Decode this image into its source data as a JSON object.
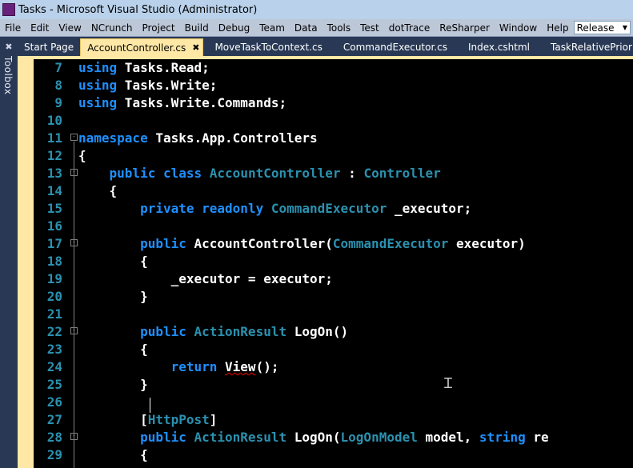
{
  "window": {
    "title": "Tasks - Microsoft Visual Studio (Administrator)"
  },
  "menu": {
    "items": [
      "File",
      "Edit",
      "View",
      "NCrunch",
      "Project",
      "Build",
      "Debug",
      "Team",
      "Data",
      "Tools",
      "Test",
      "dotTrace",
      "ReSharper",
      "Window",
      "Help"
    ],
    "configuration": "Release"
  },
  "toolbox": {
    "label": "Toolbox"
  },
  "tabs": [
    {
      "label": "Start Page",
      "active": false
    },
    {
      "label": "AccountController.cs",
      "active": true
    },
    {
      "label": "MoveTaskToContext.cs",
      "active": false
    },
    {
      "label": "CommandExecutor.cs",
      "active": false
    },
    {
      "label": "Index.cshtml",
      "active": false
    },
    {
      "label": "TaskRelativePriority.cs",
      "active": false
    }
  ],
  "editor": {
    "lines": [
      {
        "num": "7",
        "fold": "",
        "tokens": [
          [
            "kw",
            "using"
          ],
          [
            "id",
            " Tasks.Read;"
          ]
        ]
      },
      {
        "num": "8",
        "fold": "",
        "tokens": [
          [
            "kw",
            "using"
          ],
          [
            "id",
            " Tasks.Write;"
          ]
        ]
      },
      {
        "num": "9",
        "fold": "",
        "tokens": [
          [
            "kw",
            "using"
          ],
          [
            "id",
            " Tasks.Write.Commands;"
          ]
        ]
      },
      {
        "num": "10",
        "fold": "",
        "tokens": []
      },
      {
        "num": "11",
        "fold": "⊟",
        "tokens": [
          [
            "kw",
            "namespace"
          ],
          [
            "id",
            " Tasks.App.Controllers"
          ]
        ]
      },
      {
        "num": "12",
        "fold": "",
        "tokens": [
          [
            "id",
            "{"
          ]
        ]
      },
      {
        "num": "13",
        "fold": "⊟",
        "tokens": [
          [
            "id",
            "    "
          ],
          [
            "kw",
            "public"
          ],
          [
            "id",
            " "
          ],
          [
            "kw",
            "class"
          ],
          [
            "id",
            " "
          ],
          [
            "ty",
            "AccountController"
          ],
          [
            "id",
            " : "
          ],
          [
            "ty",
            "Controller"
          ]
        ]
      },
      {
        "num": "14",
        "fold": "",
        "tokens": [
          [
            "id",
            "    {"
          ]
        ]
      },
      {
        "num": "15",
        "fold": "",
        "tokens": [
          [
            "id",
            "        "
          ],
          [
            "kw",
            "private"
          ],
          [
            "id",
            " "
          ],
          [
            "kw",
            "readonly"
          ],
          [
            "id",
            " "
          ],
          [
            "ty",
            "CommandExecutor"
          ],
          [
            "id",
            " _executor;"
          ]
        ]
      },
      {
        "num": "16",
        "fold": "",
        "tokens": []
      },
      {
        "num": "17",
        "fold": "⊟",
        "tokens": [
          [
            "id",
            "        "
          ],
          [
            "kw",
            "public"
          ],
          [
            "id",
            " AccountController("
          ],
          [
            "ty",
            "CommandExecutor"
          ],
          [
            "id",
            " executor)"
          ]
        ]
      },
      {
        "num": "18",
        "fold": "",
        "tokens": [
          [
            "id",
            "        {"
          ]
        ]
      },
      {
        "num": "19",
        "fold": "",
        "tokens": [
          [
            "id",
            "            _executor = executor;"
          ]
        ]
      },
      {
        "num": "20",
        "fold": "",
        "tokens": [
          [
            "id",
            "        }"
          ]
        ]
      },
      {
        "num": "21",
        "fold": "",
        "tokens": []
      },
      {
        "num": "22",
        "fold": "⊟",
        "tokens": [
          [
            "id",
            "        "
          ],
          [
            "kw",
            "public"
          ],
          [
            "id",
            " "
          ],
          [
            "ty",
            "ActionResult"
          ],
          [
            "id",
            " LogOn()"
          ]
        ]
      },
      {
        "num": "23",
        "fold": "",
        "tokens": [
          [
            "id",
            "        {"
          ]
        ]
      },
      {
        "num": "24",
        "fold": "",
        "tokens": [
          [
            "id",
            "            "
          ],
          [
            "kw",
            "return"
          ],
          [
            "id",
            " "
          ],
          [
            "sq",
            "View"
          ],
          [
            "id",
            "();"
          ]
        ]
      },
      {
        "num": "25",
        "fold": "",
        "tokens": [
          [
            "id",
            "        }"
          ]
        ]
      },
      {
        "num": "26",
        "fold": "",
        "tokens": []
      },
      {
        "num": "27",
        "fold": "",
        "tokens": [
          [
            "id",
            "        ["
          ],
          [
            "ty",
            "HttpPost"
          ],
          [
            "id",
            "]"
          ]
        ]
      },
      {
        "num": "28",
        "fold": "⊟",
        "tokens": [
          [
            "id",
            "        "
          ],
          [
            "kw",
            "public"
          ],
          [
            "id",
            " "
          ],
          [
            "ty",
            "ActionResult"
          ],
          [
            "id",
            " LogOn("
          ],
          [
            "ty",
            "LogOnModel"
          ],
          [
            "id",
            " model, "
          ],
          [
            "kw",
            "string"
          ],
          [
            "id",
            " re"
          ]
        ]
      },
      {
        "num": "29",
        "fold": "",
        "tokens": [
          [
            "id",
            "        {"
          ]
        ]
      }
    ]
  }
}
